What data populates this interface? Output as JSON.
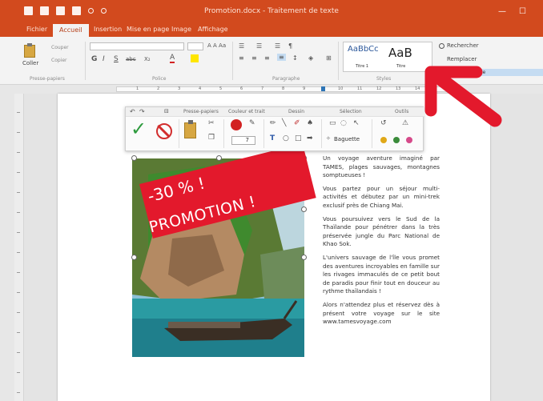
{
  "window": {
    "title": "Promotion.docx - Traitement de texte",
    "minimize_glyph": "—",
    "maximize_glyph": "☐"
  },
  "tabs": [
    "Fichier",
    "Accueil",
    "Insertion",
    "Mise en page",
    "Image",
    "Affichage"
  ],
  "ribbon": {
    "paste_label": "Coller",
    "cut_label": "Couper",
    "copy_label": "Copier",
    "font_sample": "A A Aa",
    "bold": "G",
    "italic": "I",
    "underline": "S",
    "strike": "abc",
    "subscript": "X₂",
    "font_color": "A",
    "group_clipboard": "Presse-papiers",
    "group_font": "Police",
    "group_paragraph": "Paragraphe",
    "group_styles": "Styles",
    "style_1_sample": "AaBbCc",
    "style_1_name": "Titre 1",
    "style_2_sample": "AaB",
    "style_2_name": "Titre",
    "search_label": "Rechercher",
    "replace_label": "Remplacer",
    "spell_label": "Ab     orthographique"
  },
  "ruler_numbers": [
    "1",
    "2",
    "3",
    "4",
    "5",
    "6",
    "7",
    "8",
    "9",
    "10",
    "11",
    "12",
    "13",
    "14"
  ],
  "floatbar": {
    "undo": "↶",
    "redo": "↷",
    "group_clipboard": "Presse-papiers",
    "group_color": "Couleur et trait",
    "group_draw": "Dessin",
    "group_select": "Sélection",
    "group_tools": "Outils",
    "thickness_value": "7",
    "lasso_label": "Baguette",
    "text_tool": "T"
  },
  "promo": {
    "line1": "-30 % !",
    "line2": "PROMOTION !"
  },
  "article": [
    "Un voyage aventure imaginé par TAMES, plages sauvages, montagnes somptueuses !",
    "Vous partez pour un séjour multi-activités et débutez par un mini-trek exclusif près de Chiang Mai.",
    "Vous poursuivez vers le Sud de la Thaïlande pour pénétrer dans la très préservée jungle du Parc National de Khao Sok.",
    "L'univers sauvage de l'île vous promet des aventures incroyables en famille sur les rivages immaculés de ce petit bout de paradis pour finir tout en douceur au rythme thaïlandais !",
    "Alors n'attendez plus et réservez dès à présent votre voyage sur le site www.tamesvoyage.com"
  ],
  "colors": {
    "accent": "#d24a1e",
    "arrow": "#e3192c",
    "promo_banner": "#e3192c",
    "confirm_green": "#2e9b3e"
  }
}
